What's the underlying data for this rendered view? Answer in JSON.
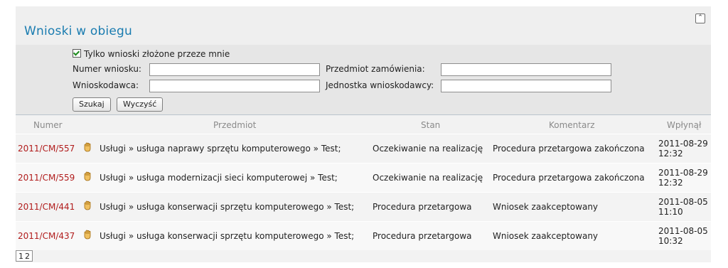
{
  "title": "Wnioski w obiegu",
  "filter": {
    "only_mine_label": "Tylko wnioski złożone przeze mnie",
    "number_label": "Numer wniosku:",
    "subject_label": "Przedmiot zamówienia:",
    "applicant_label": "Wnioskodawca:",
    "unit_label": "Jednostka wnioskodawcy:",
    "search_button": "Szukaj",
    "clear_button": "Wyczyść"
  },
  "table": {
    "headers": [
      "Numer",
      "Przedmiot",
      "Stan",
      "Komentarz",
      "Wpłynął"
    ],
    "rows": [
      {
        "number": "2011/CM/557",
        "subject": "Usługi » usługa naprawy sprzętu komputerowego » Test;",
        "status": "Oczekiwanie na realizację",
        "comment": "Procedura przetargowa zakończona",
        "date": "2011-08-29",
        "time": "12:32"
      },
      {
        "number": "2011/CM/559",
        "subject": "Usługi » usługa modernizacji sieci komputerowej » Test;",
        "status": "Oczekiwanie na realizację",
        "comment": "Procedura przetargowa zakończona",
        "date": "2011-08-29",
        "time": "12:32"
      },
      {
        "number": "2011/CM/441",
        "subject": "Usługi » usługa konserwacji sprzętu komputerowego » Test;",
        "status": "Procedura przetargowa",
        "comment": "Wniosek zaakceptowany",
        "date": "2011-08-05",
        "time": "11:10"
      },
      {
        "number": "2011/CM/437",
        "subject": "Usługi » usługa konserwacji sprzętu komputerowego » Test;",
        "status": "Procedura przetargowa",
        "comment": "Wniosek zaakceptowany",
        "date": "2011-08-05",
        "time": "10:32"
      }
    ]
  },
  "pager": {
    "pages": [
      "1",
      "2"
    ]
  },
  "icons": {
    "row_icon": "hand-icon",
    "collapse": "collapse-up-icon"
  }
}
